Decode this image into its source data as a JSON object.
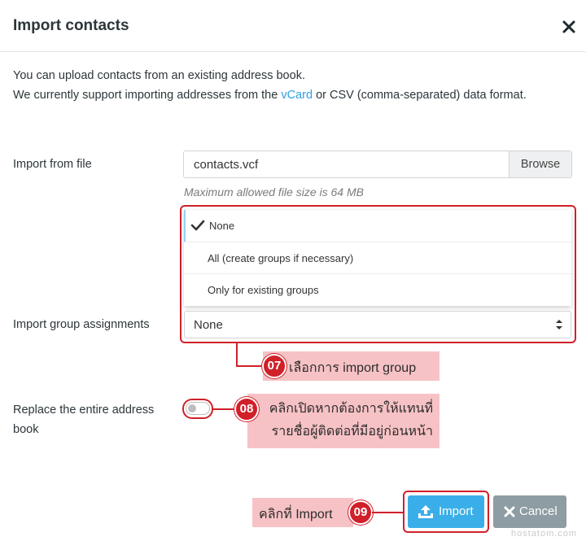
{
  "dialog": {
    "title": "Import contacts",
    "intro_line1": "You can upload contacts from an existing address book.",
    "intro_line2_before": "We currently support importing addresses from the ",
    "intro_link": "vCard",
    "intro_line2_after": " or CSV (comma-separated) data format."
  },
  "form": {
    "file_label": "Import from file",
    "file_value": "contacts.vcf",
    "browse_label": "Browse",
    "file_hint": "Maximum allowed file size is 64 MB",
    "group_label": "Import group assignments",
    "group_options": [
      "None",
      "All (create groups if necessary)",
      "Only for existing groups"
    ],
    "group_selected": "None",
    "replace_label_line1": "Replace the entire address",
    "replace_label_line2": "book",
    "replace_enabled": false
  },
  "annotations": {
    "step07_number": "07",
    "step07_text": "เลือกการ import group",
    "step08_number": "08",
    "step08_text_line1": "คลิกเปิดหากต้องการให้แทนที่",
    "step08_text_line2": "รายชื่อผู้ติดต่อที่มีอยู่ก่อนหน้า",
    "step09_number": "09",
    "step09_text": "คลิกที่ Import"
  },
  "buttons": {
    "import_label": "Import",
    "cancel_label": "Cancel"
  },
  "watermark": "hostatom.com",
  "colors": {
    "accent": "#3aaee8",
    "annotation_red": "#d0202a",
    "annotation_bg": "#f7c2c5",
    "cancel_gray": "#8e9ca3"
  }
}
